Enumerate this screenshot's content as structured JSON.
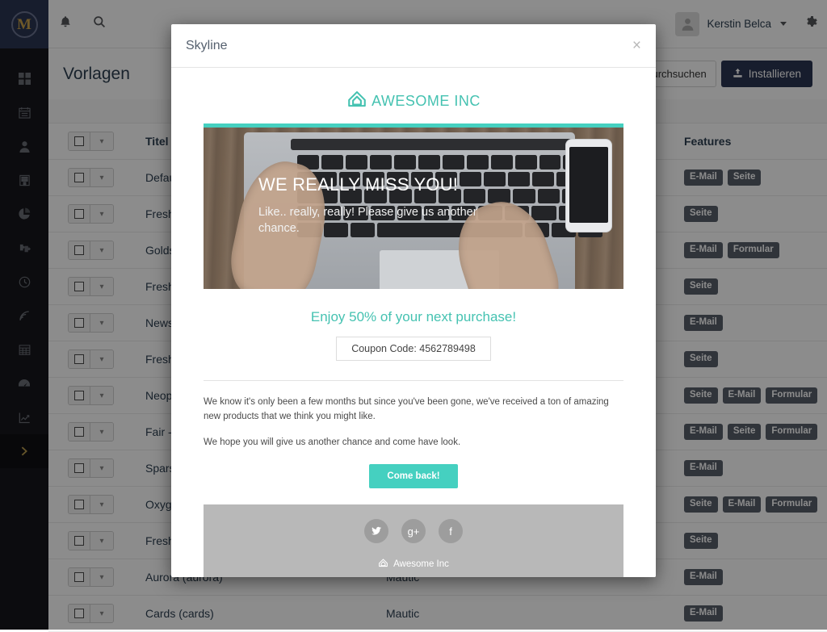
{
  "app": {
    "logo_letter": "M",
    "sidebar": {
      "items": [
        {
          "name": "dashboard",
          "icon": "grid-icon"
        },
        {
          "name": "calendar",
          "icon": "calendar-icon"
        },
        {
          "name": "contacts",
          "icon": "user-icon"
        },
        {
          "name": "companies",
          "icon": "building-icon"
        },
        {
          "name": "segments",
          "icon": "pie-chart-icon"
        },
        {
          "name": "campaigns",
          "icon": "puzzle-icon"
        },
        {
          "name": "points",
          "icon": "clock-icon"
        },
        {
          "name": "channels",
          "icon": "rss-icon"
        },
        {
          "name": "components",
          "icon": "table-icon"
        },
        {
          "name": "reports",
          "icon": "gauge-icon"
        },
        {
          "name": "analytics",
          "icon": "line-chart-icon"
        },
        {
          "name": "expand",
          "icon": "chevron-right-icon"
        }
      ]
    },
    "topbar": {
      "notifications_icon": "bell-icon",
      "search_icon": "search-icon",
      "user_name": "Kerstin Belca",
      "settings_icon": "gear-icon",
      "avatar_icon": "avatar-icon"
    },
    "page": {
      "title": "Vorlagen",
      "search_label": "Durchsuchen",
      "install_label": "Installieren",
      "install_icon": "upload-icon"
    },
    "table": {
      "headers": {
        "title": "Titel",
        "author": "",
        "features": "Features"
      },
      "rows": [
        {
          "title": "Default",
          "author": "",
          "features": [
            "E-Mail",
            "Seite"
          ]
        },
        {
          "title": "Fresh",
          "author": "",
          "features": [
            "Seite"
          ]
        },
        {
          "title": "Goldstar",
          "author": "",
          "features": [
            "E-Mail",
            "Formular"
          ]
        },
        {
          "title": "Fresh",
          "author": "",
          "features": [
            "Seite"
          ]
        },
        {
          "title": "Newsletter",
          "author": "",
          "features": [
            "E-Mail"
          ]
        },
        {
          "title": "Fresh",
          "author": "",
          "features": [
            "Seite"
          ]
        },
        {
          "title": "Neopolitan",
          "author": "",
          "features": [
            "Seite",
            "E-Mail",
            "Formular"
          ]
        },
        {
          "title": "Fair - S",
          "author": "",
          "features": [
            "E-Mail",
            "Seite",
            "Formular"
          ]
        },
        {
          "title": "Sparse",
          "author": "",
          "features": [
            "E-Mail"
          ]
        },
        {
          "title": "Oxygen",
          "author": "",
          "features": [
            "Seite",
            "E-Mail",
            "Formular"
          ]
        },
        {
          "title": "Fresh",
          "author": "",
          "features": [
            "Seite"
          ]
        },
        {
          "title": "Aurora (aurora)",
          "author": "Mautic",
          "features": [
            "E-Mail"
          ]
        },
        {
          "title": "Cards (cards)",
          "author": "Mautic",
          "features": [
            "E-Mail"
          ]
        }
      ]
    }
  },
  "modal": {
    "title": "Skyline",
    "close_label": "×",
    "email": {
      "brand_name": "AWESOME INC",
      "brand_icon": "house-logo-icon",
      "hero": {
        "heading": "WE REALLY MISS YOU!",
        "subtext": "Like.. really, really! Please give us another chance."
      },
      "offer_text": "Enjoy 50% of your next purchase!",
      "coupon_text": "Coupon Code: 4562789498",
      "paragraph_1": "We know it's only been a few months but since you've been gone, we've received a ton of amazing new products that we think you might like.",
      "paragraph_2": "We hope you will give us another chance and come have look.",
      "cta_label": "Come back!",
      "socials": [
        {
          "name": "twitter",
          "glyph": "🐦"
        },
        {
          "name": "google-plus",
          "glyph": "g+"
        },
        {
          "name": "facebook",
          "glyph": "f"
        }
      ],
      "footer_brand": "Awesome Inc"
    }
  },
  "colors": {
    "brand_teal": "#45c2b1",
    "cta_teal": "#45d0c0",
    "navy": "#2b3553",
    "badge_gray": "#585f6b"
  }
}
